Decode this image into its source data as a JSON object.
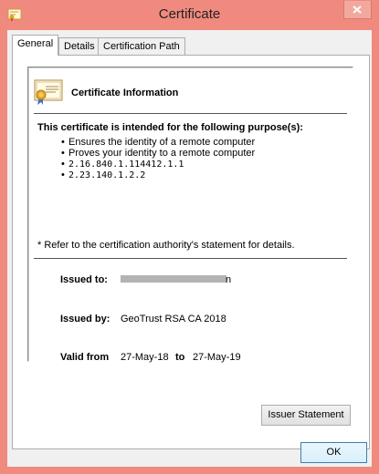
{
  "window": {
    "title": "Certificate"
  },
  "tabs": [
    {
      "label": "General",
      "active": true
    },
    {
      "label": "Details",
      "active": false
    },
    {
      "label": "Certification Path",
      "active": false
    }
  ],
  "general": {
    "heading": "Certificate Information",
    "purpose_heading": "This certificate is intended for the following purpose(s):",
    "purposes": [
      "Ensures the identity of a remote computer",
      "Proves your identity to a remote computer",
      "2.16.840.1.114412.1.1",
      "2.23.140.1.2.2"
    ],
    "note": "* Refer to the certification authority's statement for details.",
    "issued_to_label": "Issued to:",
    "issued_to_value_tail": "n",
    "issued_by_label": "Issued by:",
    "issued_by_value": "GeoTrust RSA CA 2018",
    "valid_from_label": "Valid from",
    "valid_from_value": "27-May-18",
    "valid_to_label": "to",
    "valid_to_value": "27-May-19"
  },
  "buttons": {
    "issuer_statement": "Issuer Statement",
    "ok": "OK"
  },
  "colors": {
    "frame": "#f08a7e",
    "dialog_bg": "#f0f0f0",
    "focus_border": "#3c7fb1"
  },
  "icons": {
    "window": "certificate-window-icon",
    "close": "close-icon",
    "certificate": "certificate-icon"
  }
}
